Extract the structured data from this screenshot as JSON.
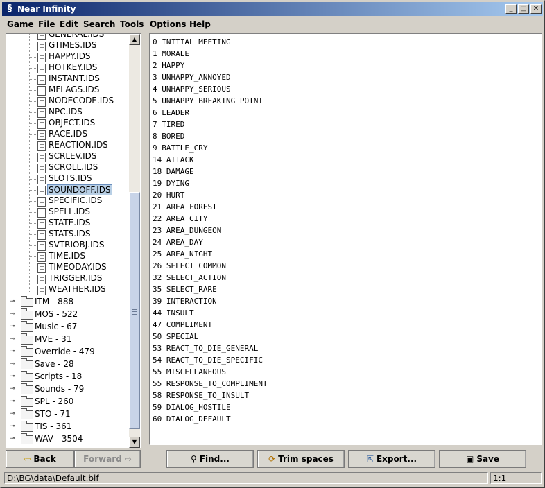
{
  "window": {
    "title": "Near Infinity",
    "minimize": "_",
    "maximize": "□",
    "close": "✕"
  },
  "menubar": {
    "items": [
      "Game",
      "File",
      "Edit",
      "Search",
      "Tools",
      "Options",
      "Help"
    ]
  },
  "tree": {
    "partial_top": "GENERAL.IDS",
    "files": [
      "GTIMES.IDS",
      "HAPPY.IDS",
      "HOTKEY.IDS",
      "INSTANT.IDS",
      "MFLAGS.IDS",
      "NODECODE.IDS",
      "NPC.IDS",
      "OBJECT.IDS",
      "RACE.IDS",
      "REACTION.IDS",
      "SCRLEV.IDS",
      "SCROLL.IDS",
      "SLOTS.IDS",
      "SOUNDOFF.IDS",
      "SPECIFIC.IDS",
      "SPELL.IDS",
      "STATE.IDS",
      "STATS.IDS",
      "SVTRIOBJ.IDS",
      "TIME.IDS",
      "TIMEODAY.IDS",
      "TRIGGER.IDS",
      "WEATHER.IDS"
    ],
    "selected_file": "SOUNDOFF.IDS",
    "folders": [
      "ITM - 888",
      "MOS - 522",
      "Music - 67",
      "MVE - 31",
      "Override - 479",
      "Save - 28",
      "Scripts - 18",
      "Sounds - 79",
      "SPL - 260",
      "STO - 71",
      "TIS - 361",
      "WAV - 3504"
    ]
  },
  "content": {
    "lines": [
      "0 INITIAL_MEETING",
      "1 MORALE",
      "2 HAPPY",
      "3 UNHAPPY_ANNOYED",
      "4 UNHAPPY_SERIOUS",
      "5 UNHAPPY_BREAKING_POINT",
      "6 LEADER",
      "7 TIRED",
      "8 BORED",
      "9 BATTLE_CRY",
      "14 ATTACK",
      "18 DAMAGE",
      "19 DYING",
      "20 HURT",
      "21 AREA_FOREST",
      "22 AREA_CITY",
      "23 AREA_DUNGEON",
      "24 AREA_DAY",
      "25 AREA_NIGHT",
      "26 SELECT_COMMON",
      "32 SELECT_ACTION",
      "35 SELECT_RARE",
      "39 INTERACTION",
      "44 INSULT",
      "47 COMPLIMENT",
      "50 SPECIAL",
      "53 REACT_TO_DIE_GENERAL",
      "54 REACT_TO_DIE_SPECIFIC",
      "55 MISCELLANEOUS",
      "55 RESPONSE_TO_COMPLIMENT",
      "58 RESPONSE_TO_INSULT",
      "59 DIALOG_HOSTILE",
      "60 DIALOG_DEFAULT"
    ]
  },
  "buttons": {
    "back": "Back",
    "forward": "Forward",
    "find": "Find...",
    "trim": "Trim spaces",
    "export": "Export...",
    "save": "Save"
  },
  "statusbar": {
    "path": "D:\\BG\\data\\Default.bif",
    "position": "1:1"
  },
  "colors": {
    "title_gradient_start": "#0a246a",
    "title_gradient_end": "#a6caf0",
    "selection": "#b8cfe5",
    "chrome": "#d4d0c8"
  }
}
